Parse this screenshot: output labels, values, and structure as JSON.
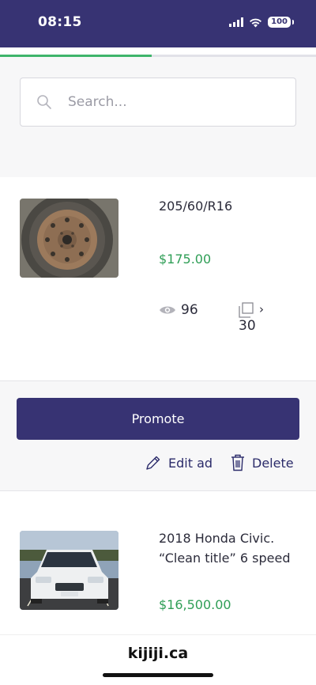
{
  "status_bar": {
    "time": "08:15",
    "battery": "100"
  },
  "page_load_progress": 0.48,
  "search": {
    "placeholder": "Search..."
  },
  "listings": [
    {
      "title": "205/60/R16",
      "price": "$175.00",
      "views": "96",
      "copies": "30",
      "image": "steel-wheel-tire-photo"
    },
    {
      "title": "2018 Honda Civic. “Clean title” 6 speed",
      "price": "$16,500.00",
      "image": "white-honda-civic-photo"
    }
  ],
  "actions": {
    "promote_label": "Promote",
    "edit_label": "Edit ad",
    "delete_label": "Delete"
  },
  "footer": {
    "domain": "kijiji.ca"
  },
  "colors": {
    "brand": "#373373",
    "price": "#2f9e56",
    "progress": "#3fb56b"
  }
}
